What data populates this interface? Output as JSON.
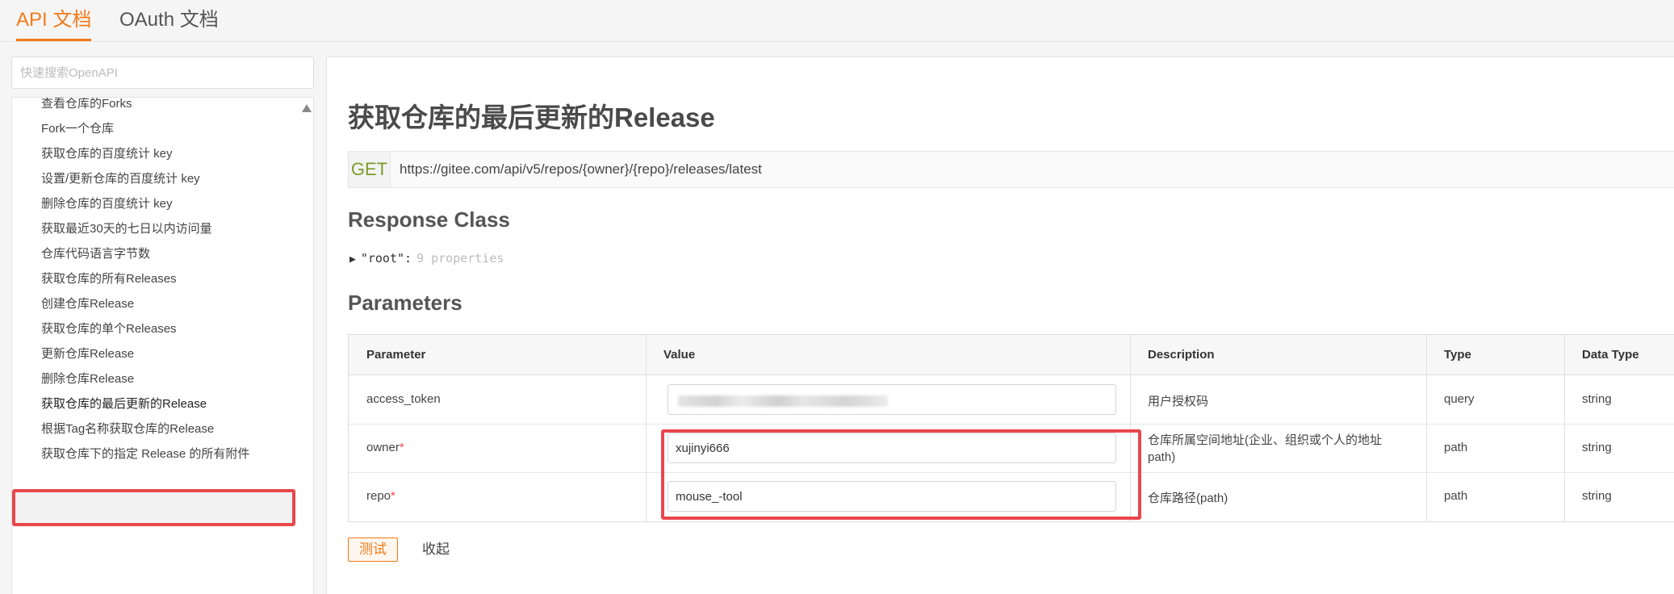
{
  "top_tabs": [
    {
      "label": "API 文档",
      "active": true
    },
    {
      "label": "OAuth 文档",
      "active": false
    }
  ],
  "search": {
    "placeholder": "快速搜索OpenAPI",
    "value": ""
  },
  "sidebar": {
    "items": [
      {
        "label": "查看仓库的Forks"
      },
      {
        "label": "Fork一个仓库"
      },
      {
        "label": "获取仓库的百度统计 key"
      },
      {
        "label": "设置/更新仓库的百度统计 key"
      },
      {
        "label": "删除仓库的百度统计 key"
      },
      {
        "label": "获取最近30天的七日以内访问量"
      },
      {
        "label": "仓库代码语言字节数"
      },
      {
        "label": "获取仓库的所有Releases"
      },
      {
        "label": "创建仓库Release"
      },
      {
        "label": "获取仓库的单个Releases"
      },
      {
        "label": "更新仓库Release"
      },
      {
        "label": "删除仓库Release"
      },
      {
        "label": "获取仓库的最后更新的Release",
        "active": true
      },
      {
        "label": "根据Tag名称获取仓库的Release"
      },
      {
        "label": "获取仓库下的指定 Release 的所有附件"
      }
    ]
  },
  "main": {
    "title": "获取仓库的最后更新的Release",
    "method": "GET",
    "url": "https://gitee.com/api/v5/repos/{owner}/{repo}/releases/latest",
    "response_class_title": "Response Class",
    "schema": {
      "toggle": "▶",
      "root_key": "\"root\":",
      "properties": "9 properties"
    },
    "parameters_title": "Parameters",
    "table": {
      "headers": [
        "Parameter",
        "Value",
        "Description",
        "Type",
        "Data Type"
      ],
      "rows": [
        {
          "parameter": "access_token",
          "required": false,
          "value": "",
          "description": "用户授权码",
          "type": "query",
          "data_type": "string"
        },
        {
          "parameter": "owner",
          "required": true,
          "required_mark": "*",
          "value": "xujinyi666",
          "description": "仓库所属空间地址(企业、组织或个人的地址path)",
          "type": "path",
          "data_type": "string"
        },
        {
          "parameter": "repo",
          "required": true,
          "required_mark": "*",
          "value": "mouse_-tool",
          "description": "仓库路径(path)",
          "type": "path",
          "data_type": "string"
        }
      ]
    },
    "buttons": {
      "test_label": "测试",
      "collapse_label": "收起"
    }
  },
  "colors": {
    "accent": "#f27a18",
    "highlight_box": "#e8474c",
    "method_get": "#7d9b2a"
  }
}
